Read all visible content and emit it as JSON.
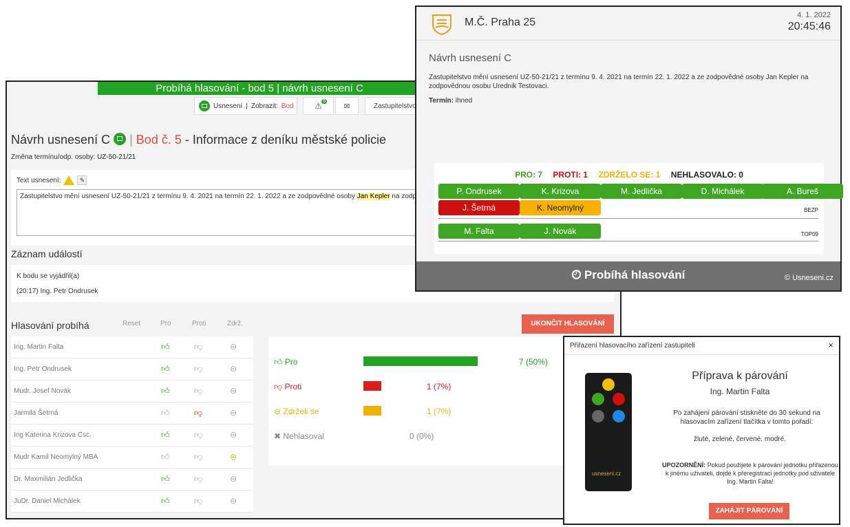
{
  "main": {
    "banner": "Probíhá hlasování - bod 5 | návrh usnesení C",
    "toolbar": {
      "usneseni_label": "Usnesení",
      "separator": "|",
      "zobrazit_label": "Zobrazit:",
      "bod_value": "Bod",
      "warn_badge": "6",
      "zastupitelstvo": "Zastupitelstvo"
    },
    "title_prefix": "Návrh usnesení C",
    "title_bod": "Bod č. 5",
    "title_suffix": "- Informace z deníku městské policie",
    "subtitle_label": "Změna termínu/odp. osoby:",
    "subtitle_value": "UZ-50-21/21",
    "text_label": "Text usnesení:",
    "text_before": "Zastupitelstvo mění usnesení UZ-50-21/21 z termínu 9. 4. 2021 na termín 22. 1. 2022 a ze zodpovědné osoby ",
    "text_highlight": "Jan Kepler",
    "text_after": " na zodpovědnou osobu",
    "zaznam_heading": "Záznam událostí",
    "zaznam_line1": "K bodu se vyjádřil(a)",
    "zaznam_line2": "(20:17) Ing. Petr Ondrusek",
    "hlas_heading": "Hlasování probíhá",
    "col_reset": "Reset",
    "col_pro": "Pro",
    "col_proti": "Proti",
    "col_zdrz": "Zdrž.",
    "end_button": "UKONČIT HLASOVÁNÍ",
    "voters": [
      {
        "name": "Ing. Martin Falta",
        "vote": "pro"
      },
      {
        "name": "Ing. Petr Ondrusek",
        "vote": "pro"
      },
      {
        "name": "Mudr. Josef Novák",
        "vote": "pro"
      },
      {
        "name": "Jarmila Šetrná",
        "vote": "proti"
      },
      {
        "name": "Ing Katerina Krizova Csc.",
        "vote": "pro"
      },
      {
        "name": "Mudr Kamil Neomylný MBA",
        "vote": "zdrz"
      },
      {
        "name": "Dr. Maxmilián Jedlička",
        "vote": "pro"
      },
      {
        "name": "JuDr. Daniel Michálek",
        "vote": "pro"
      }
    ],
    "results": [
      {
        "label": "Pro",
        "value": "7 (50%)",
        "fraction": 0.5,
        "color": "#22a323"
      },
      {
        "label": "Proti",
        "value": "1 (7%)",
        "fraction": 0.07,
        "color": "#d62020"
      },
      {
        "label": "Zdrželi se",
        "value": "1 (7%)",
        "fraction": 0.07,
        "color": "#f0b000"
      },
      {
        "label": "Nehlasoval",
        "value": "0 (0%)",
        "fraction": 0,
        "color": "#888888"
      }
    ]
  },
  "projector": {
    "city": "M.Č. Praha 25",
    "date": "4. 1. 2022",
    "time": "20:45:46",
    "heading": "Návrh usnesení C",
    "text": "Zastupitelstvo mění usnesení UZ-50-21/21 z termínu 9. 4. 2021 na termín 22. 1. 2022 a ze zodpovědné osoby Jan Kepler na zodpovědnou osobu Urednik Testovaci.",
    "term_label": "Termín:",
    "term_value": "ihned",
    "stat_pro": "PRO: 7",
    "stat_proti": "PROTI: 1",
    "stat_zdrz": "ZDRŽELO SE: 1",
    "stat_nehl": "NEHLASOVALO: 0",
    "group1": [
      {
        "name": "P. Ondrusek",
        "vote": "g"
      },
      {
        "name": "K. Krizova",
        "vote": "g"
      },
      {
        "name": "M. Jedlička",
        "vote": "g"
      },
      {
        "name": "D. Michálek",
        "vote": "g"
      },
      {
        "name": "A. Bureš",
        "vote": "g"
      },
      {
        "name": "J. Šetrná",
        "vote": "r"
      },
      {
        "name": "K. Neomylný",
        "vote": "y"
      }
    ],
    "group1_name": "BEZP",
    "group2": [
      {
        "name": "M. Falta",
        "vote": "g"
      },
      {
        "name": "J. Novák",
        "vote": "g"
      }
    ],
    "group2_name": "TOP09",
    "footer": "Probíhá hlasování",
    "copyright": "© Usneseni.cz"
  },
  "modal": {
    "header": "Přiřazení hlasovacího zařízení zastupiteli",
    "close": "×",
    "title": "Příprava k párování",
    "name": "Ing. Martin Falta",
    "p1": "Po zahájení párování stiskněte do 30 sekund na hlasovacím zařízení tlačítka v tomto pořadí:",
    "p2": "žluté, zelené, červené, modré.",
    "warn_label": "UPOZORNĚNÍ:",
    "warn_text": "Pokud použijete k párování jednotku přiřazenou k jinému uživateli, dojde k přeregistraci jednotky pod uživatele Ing. Martin Falta!",
    "button": "ZAHÁJIT PÁROVÁNÍ",
    "remote_logo": "usneseni.cz"
  }
}
